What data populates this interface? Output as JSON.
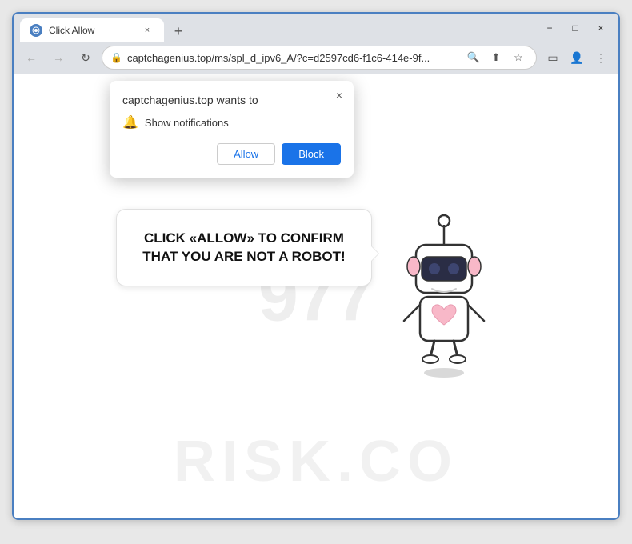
{
  "browser": {
    "tab": {
      "favicon_color": "#4a7fc1",
      "title": "Click Allow",
      "close_label": "×"
    },
    "new_tab_label": "+",
    "window_controls": {
      "minimize_label": "−",
      "maximize_label": "□",
      "close_label": "×"
    },
    "nav": {
      "back_label": "←",
      "forward_label": "→",
      "reload_label": "↻"
    },
    "address_bar": {
      "lock_icon": "🔒",
      "url": "captchagenius.top/ms/spl_d_ipv6_A/?c=d2597cd6-f1c6-414e-9f...",
      "search_icon": "🔍",
      "share_icon": "⬆",
      "star_icon": "☆",
      "sidebar_icon": "▭",
      "profile_icon": "👤",
      "menu_icon": "⋮"
    }
  },
  "notification_popup": {
    "site": "captchagenius.top wants to",
    "close_label": "×",
    "bell_icon": "🔔",
    "notification_text": "Show notifications",
    "allow_label": "Allow",
    "block_label": "Block"
  },
  "page": {
    "captcha_message": "CLICK «ALLOW» TO CONFIRM THAT YOU ARE NOT A ROBOT!",
    "watermark": "RISK.CO",
    "background_number": "977"
  }
}
